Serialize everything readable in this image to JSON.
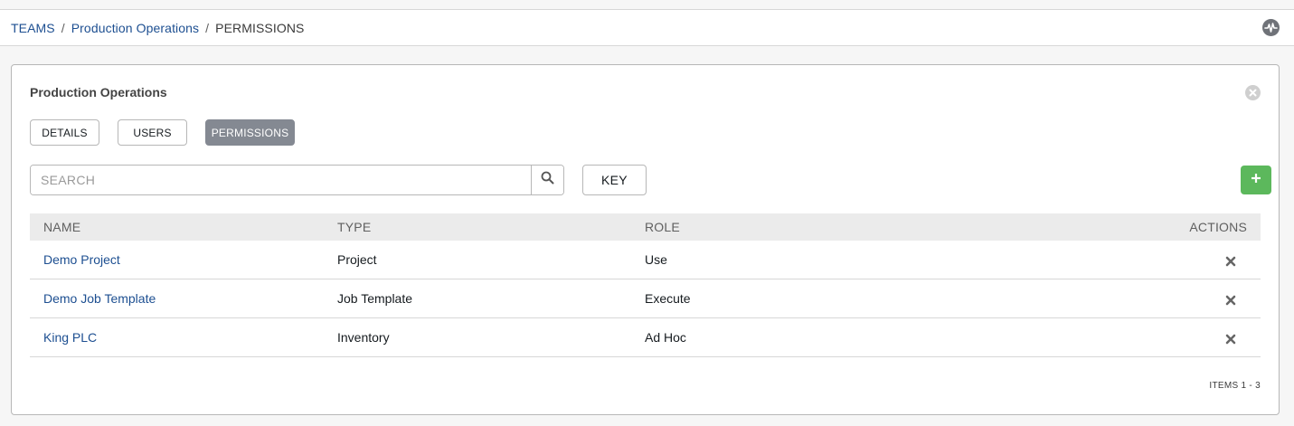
{
  "breadcrumb": {
    "teams": "TEAMS",
    "team": "Production Operations",
    "current": "PERMISSIONS",
    "separator": "/"
  },
  "header": {
    "activity_icon": "activity-stream-icon"
  },
  "panel": {
    "title": "Production Operations",
    "close_icon": "close-icon"
  },
  "tabs": [
    {
      "label": "DETAILS",
      "active": false
    },
    {
      "label": "USERS",
      "active": false
    },
    {
      "label": "PERMISSIONS",
      "active": true
    }
  ],
  "search": {
    "placeholder": "SEARCH",
    "value": "",
    "icon": "search-icon"
  },
  "key_button": {
    "label": "KEY"
  },
  "add_button": {
    "icon": "plus-icon",
    "color": "#5cb85c"
  },
  "table": {
    "columns": [
      "NAME",
      "TYPE",
      "ROLE",
      "ACTIONS"
    ],
    "rows": [
      {
        "name": "Demo Project",
        "type": "Project",
        "role": "Use"
      },
      {
        "name": "Demo Job Template",
        "type": "Job Template",
        "role": "Execute"
      },
      {
        "name": "King PLC",
        "type": "Inventory",
        "role": "Ad Hoc"
      }
    ]
  },
  "pager": {
    "label": "ITEMS",
    "range": "1 - 3"
  },
  "colors": {
    "link": "#1d4f91",
    "active_tab": "#848992",
    "add": "#5cb85c"
  }
}
